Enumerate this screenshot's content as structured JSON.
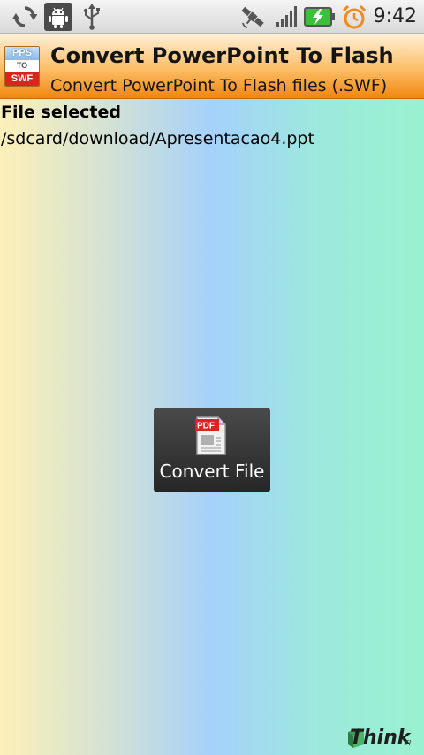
{
  "status_bar": {
    "time": "9:42",
    "icons": [
      "sync-icon",
      "android-debug-icon",
      "usb-icon",
      "gps-satellite-icon",
      "signal-bars-icon",
      "battery-charging-icon",
      "alarm-clock-icon"
    ]
  },
  "app_bar": {
    "icon_lines": [
      "PPS",
      "TO",
      "SWF"
    ],
    "title": "Convert PowerPoint To Flash",
    "subtitle": "Convert PowerPoint To Flash files (.SWF)"
  },
  "main": {
    "file_label": "File selected",
    "file_path": "/sdcard/download/Apresentacao4.ppt",
    "convert_button": {
      "label": "Convert File",
      "icon": "pdf-document-icon",
      "icon_text": "PDF"
    },
    "brand": {
      "text": "Think",
      "suffix": "TI"
    }
  },
  "colors": {
    "title_bar_accent": "#f0870f",
    "button_bg": "#333333",
    "pdf_red": "#d8261c",
    "battery_green": "#3cc03c"
  }
}
